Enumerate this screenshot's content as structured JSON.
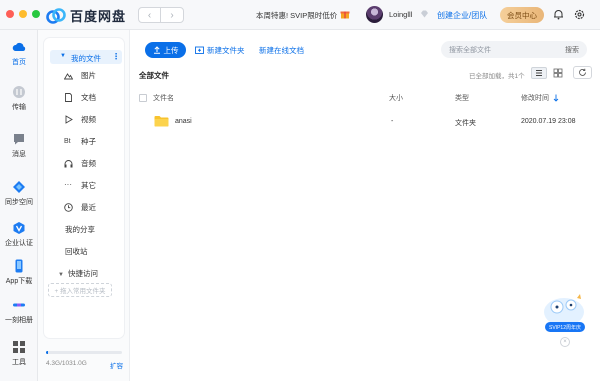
{
  "header": {
    "app_name": "百度网盘",
    "nav_back": "‹",
    "nav_forward": "›",
    "promo_text": "本周特惠! SVIP限时低价",
    "username": "Loinglll",
    "enterprise_link": "创建企业/团队",
    "member_center": "会员中心"
  },
  "rail": {
    "items": [
      {
        "label": "首页",
        "icon": "cloud-icon",
        "active": true
      },
      {
        "label": "传输",
        "icon": "transfer-icon"
      },
      {
        "label": "消息",
        "icon": "message-icon"
      },
      {
        "label": "同步空间",
        "icon": "sync-icon"
      },
      {
        "label": "企业认证",
        "icon": "enterprise-icon"
      },
      {
        "label": "App下载",
        "icon": "phone-icon"
      },
      {
        "label": "一刻相册",
        "icon": "album-icon"
      },
      {
        "label": "工具",
        "icon": "tools-icon"
      }
    ]
  },
  "sidebar": {
    "my_files": "我的文件",
    "categories": [
      {
        "label": "图片",
        "icon": "image-icon"
      },
      {
        "label": "文档",
        "icon": "document-icon"
      },
      {
        "label": "视频",
        "icon": "video-icon"
      },
      {
        "label": "种子",
        "icon": "bt-icon"
      },
      {
        "label": "音频",
        "icon": "headphones-icon"
      },
      {
        "label": "其它",
        "icon": "more-icon"
      },
      {
        "label": "最近",
        "icon": "clock-icon"
      }
    ],
    "my_share": "我的分享",
    "recycle": "回收站",
    "quick_access": "快捷访问",
    "quick_access_add": "+ 拖入常用文件夹",
    "storage_text": "4.3G/1031.0G",
    "storage_used_fraction": 0.0042,
    "expand": "扩容"
  },
  "toolbar": {
    "upload": "上传",
    "new_folder": "新建文件夹",
    "new_online_doc": "新建在线文档",
    "search_placeholder": "搜索全部文件",
    "search_button": "搜索"
  },
  "content": {
    "breadcrumb": "全部文件",
    "loaded_text": "已全部加载，共1个",
    "columns": {
      "name": "文件名",
      "size": "大小",
      "type": "类型",
      "modified": "修改时间"
    },
    "rows": [
      {
        "name": "anasi",
        "size": "-",
        "type": "文件夹",
        "modified": "2020.07.19 23:08"
      }
    ]
  },
  "promo_widget": {
    "label": "SVIP12周年庆"
  },
  "colors": {
    "accent": "#0a6fe8",
    "member_gold": "#e9b678"
  }
}
